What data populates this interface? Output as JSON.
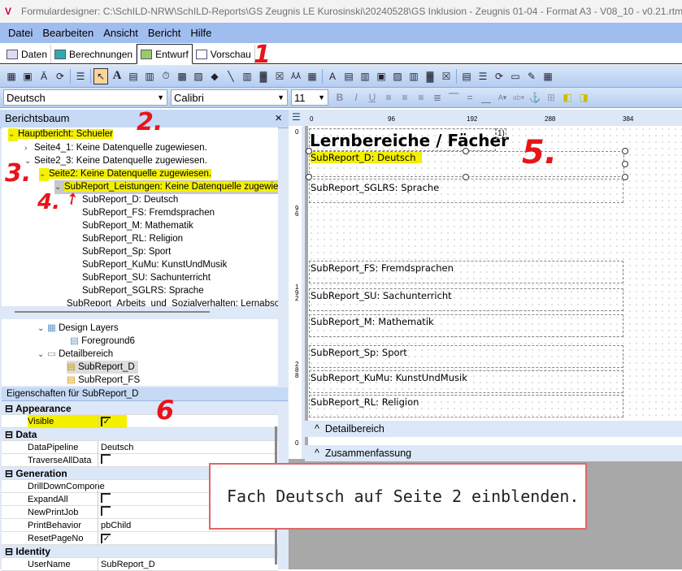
{
  "window": {
    "title": "Formulardesigner: C:\\SchILD-NRW\\SchILD-Reports\\GS Zeugnis LE Kurosinski\\20240528\\GS Inklusion - Zeugnis 01-04 - Format A3 - V08_10 - v0.21.rtm"
  },
  "menu": [
    "Datei",
    "Bearbeiten",
    "Ansicht",
    "Bericht",
    "Hilfe"
  ],
  "tabs": [
    {
      "label": "Daten"
    },
    {
      "label": "Berechnungen"
    },
    {
      "label": "Entwurf",
      "active": true
    },
    {
      "label": "Vorschau"
    }
  ],
  "format_toolbar": {
    "datapipeline": "Deutsch",
    "font": "Calibri",
    "size": "11"
  },
  "report_tree": {
    "title": "Berichtsbaum",
    "close": "×",
    "items": [
      "Hauptbericht: Schueler",
      "Seite4_1: Keine Datenquelle zugewiesen.",
      "Seite2_3: Keine Datenquelle zugewiesen.",
      "Seite2: Keine Datenquelle zugewiesen.",
      "SubReport_Leistungen: Keine Datenquelle zugewiesen.",
      "SubReport_D: Deutsch",
      "SubReport_FS: Fremdsprachen",
      "SubReport_M: Mathematik",
      "SubReport_RL: Religion",
      "SubReport_Sp: Sport",
      "SubReport_KuMu: KunstUndMusik",
      "SubReport_SU: Sachunterricht",
      "SubReport_SGLRS: Sprache",
      "SubReport_Arbeits_und_Sozialverhalten: Lernabschnitt"
    ]
  },
  "layer_tree": [
    "Design Layers",
    "Foreground6",
    "Detailbereich",
    "SubReport_D",
    "SubReport_FS"
  ],
  "properties": {
    "title": "Eigenschaften für SubReport_D",
    "rows": [
      {
        "cat": "Appearance"
      },
      {
        "name": "Visible",
        "check": true
      },
      {
        "cat": "Data"
      },
      {
        "name": "DataPipeline",
        "value": "Deutsch"
      },
      {
        "name": "TraverseAllData",
        "check": false
      },
      {
        "cat": "Generation"
      },
      {
        "name": "DrillDownCompone",
        "value": ""
      },
      {
        "name": "ExpandAll",
        "check": false
      },
      {
        "name": "NewPrintJob",
        "check": false
      },
      {
        "name": "PrintBehavior",
        "value": "pbChild"
      },
      {
        "name": "ResetPageNo",
        "check": true
      },
      {
        "cat": "Identity"
      },
      {
        "name": "UserName",
        "value": "SubReport_D"
      }
    ]
  },
  "designer": {
    "ruler_h": [
      "0",
      "96",
      "192",
      "288",
      "384"
    ],
    "ruler_v": [
      "0",
      "96",
      "192",
      "288",
      "0"
    ],
    "heading": "Lernbereiche / Fächer",
    "footnote": "1)",
    "subreports": [
      "SubReport_D: Deutsch",
      "SubReport_SGLRS: Sprache",
      "SubReport_FS: Fremdsprachen",
      "SubReport_SU: Sachunterricht",
      "SubReport_M: Mathematik",
      "SubReport_Sp: Sport",
      "SubReport_KuMu: KunstUndMusik",
      "SubReport_RL: Religion"
    ],
    "bands": [
      "Detailbereich",
      "Zusammenfassung"
    ],
    "band_caret": "^"
  },
  "callout": "Fach Deutsch auf Seite 2 einblenden.",
  "annotations": [
    "1",
    "2.",
    "3.",
    "4.",
    "5.",
    "6"
  ],
  "colors": {
    "highlight": "#f4f000",
    "annotation": "#e8141a",
    "menubar": "#a0bdf0"
  }
}
